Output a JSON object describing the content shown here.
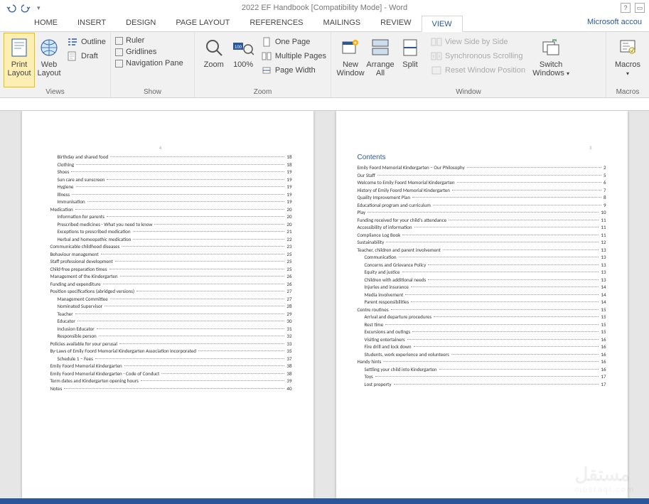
{
  "titlebar": {
    "title": "2022 EF Handbook [Compatibility Mode] - Word",
    "account": "Microsoft accou"
  },
  "tabs": {
    "items": [
      "HOME",
      "INSERT",
      "DESIGN",
      "PAGE LAYOUT",
      "REFERENCES",
      "MAILINGS",
      "REVIEW",
      "VIEW"
    ],
    "active": "VIEW"
  },
  "ribbon": {
    "views": {
      "print_layout": "Print Layout",
      "web_layout": "Web Layout",
      "outline": "Outline",
      "draft": "Draft",
      "group_label": "Views"
    },
    "show": {
      "ruler": "Ruler",
      "gridlines": "Gridlines",
      "navigation_pane": "Navigation Pane",
      "group_label": "Show"
    },
    "zoom": {
      "zoom": "Zoom",
      "hundred": "100%",
      "one_page": "One Page",
      "multiple_pages": "Multiple Pages",
      "page_width": "Page Width",
      "group_label": "Zoom"
    },
    "window": {
      "new_window": "New Window",
      "arrange_all": "Arrange All",
      "split": "Split",
      "view_side": "View Side by Side",
      "sync_scroll": "Synchronous Scrolling",
      "reset_pos": "Reset Window Position",
      "switch_windows": "Switch Windows",
      "group_label": "Window"
    },
    "macros": {
      "macros": "Macros",
      "group_label": "Macros"
    }
  },
  "left_page": {
    "number": "4",
    "toc": [
      {
        "t": "Birthday and shared food",
        "p": "18",
        "i": 2
      },
      {
        "t": "Clothing",
        "p": "18",
        "i": 2
      },
      {
        "t": "Shoes",
        "p": "19",
        "i": 2
      },
      {
        "t": "Sun care and sunscreen",
        "p": "19",
        "i": 2
      },
      {
        "t": "Hygiene",
        "p": "19",
        "i": 2
      },
      {
        "t": "Illness",
        "p": "19",
        "i": 2
      },
      {
        "t": "Immunisation",
        "p": "19",
        "i": 2
      },
      {
        "t": "Medication",
        "p": "20",
        "i": 1
      },
      {
        "t": "Information for parents",
        "p": "20",
        "i": 2
      },
      {
        "t": "Prescribed medicines - What you need to know",
        "p": "20",
        "i": 2
      },
      {
        "t": "Exceptions to prescribed medication",
        "p": "21",
        "i": 2
      },
      {
        "t": "Herbal and homeopathic medication",
        "p": "22",
        "i": 2
      },
      {
        "t": "Communicable childhood diseases",
        "p": "23",
        "i": 1
      },
      {
        "t": "Behaviour management",
        "p": "25",
        "i": 1
      },
      {
        "t": "Staff professional development",
        "p": "25",
        "i": 1
      },
      {
        "t": "Child-free preparation times",
        "p": "25",
        "i": 1
      },
      {
        "t": "Management of the Kindergarten",
        "p": "26",
        "i": 1
      },
      {
        "t": "Funding and expenditure",
        "p": "26",
        "i": 1
      },
      {
        "t": "Position specifications (abridged versions)",
        "p": "27",
        "i": 1
      },
      {
        "t": "Management Committee",
        "p": "27",
        "i": 2
      },
      {
        "t": "Nominated Supervisor",
        "p": "28",
        "i": 2
      },
      {
        "t": "Teacher",
        "p": "29",
        "i": 2
      },
      {
        "t": "Educator",
        "p": "30",
        "i": 2
      },
      {
        "t": "Inclusion Educator",
        "p": "31",
        "i": 2
      },
      {
        "t": "Responsible person",
        "p": "32",
        "i": 2
      },
      {
        "t": "Policies available for your perusal",
        "p": "33",
        "i": 1
      },
      {
        "t": "By-Laws of Emily Foord Memorial Kindergarten Association Incorporated",
        "p": "35",
        "i": 1
      },
      {
        "t": "Schedule 1 – Fees",
        "p": "37",
        "i": 2
      },
      {
        "t": "Emily Foord Memorial Kindergarten",
        "p": "38",
        "i": 1
      },
      {
        "t": "Emily Foord Memorial Kindergarten - Code of Conduct",
        "p": "38",
        "i": 1
      },
      {
        "t": "Term dates and Kindergarten opening hours",
        "p": "39",
        "i": 1
      },
      {
        "t": "Notes",
        "p": "40",
        "i": 1
      }
    ]
  },
  "right_page": {
    "number": "3",
    "heading": "Contents",
    "toc": [
      {
        "t": "Emily Foord Memorial Kindergarten – Our Philosophy",
        "p": "2",
        "i": 0
      },
      {
        "t": "Our Staff",
        "p": "5",
        "i": 0
      },
      {
        "t": "Welcome to Emily Foord Memorial Kindergarten",
        "p": "6",
        "i": 0
      },
      {
        "t": "History of Emily Foord Memorial Kindergarten",
        "p": "7",
        "i": 0
      },
      {
        "t": "Quality Improvement Plan",
        "p": "8",
        "i": 0
      },
      {
        "t": "Educational program and curriculum",
        "p": "9",
        "i": 0
      },
      {
        "t": "Play",
        "p": "10",
        "i": 0
      },
      {
        "t": "Funding received for your child's attendance",
        "p": "11",
        "i": 0
      },
      {
        "t": "Accessibility of information",
        "p": "11",
        "i": 0
      },
      {
        "t": "Compliance Log Book",
        "p": "11",
        "i": 0
      },
      {
        "t": "Sustainability",
        "p": "12",
        "i": 0
      },
      {
        "t": "Teacher, children and parent involvement",
        "p": "13",
        "i": 0
      },
      {
        "t": "Communication",
        "p": "13",
        "i": 1
      },
      {
        "t": "Concerns and Grievance Policy",
        "p": "13",
        "i": 1
      },
      {
        "t": "Equity and justice",
        "p": "13",
        "i": 1
      },
      {
        "t": "Children with additional needs",
        "p": "13",
        "i": 1
      },
      {
        "t": "Injuries and insurance",
        "p": "14",
        "i": 1
      },
      {
        "t": "Media involvement",
        "p": "14",
        "i": 1
      },
      {
        "t": "Parent responsibilities",
        "p": "14",
        "i": 1
      },
      {
        "t": "Centre routines",
        "p": "15",
        "i": 0
      },
      {
        "t": "Arrival and departure procedures",
        "p": "15",
        "i": 1
      },
      {
        "t": "Rest time",
        "p": "15",
        "i": 1
      },
      {
        "t": "Excursions and outings",
        "p": "15",
        "i": 1
      },
      {
        "t": "Visiting entertainers",
        "p": "16",
        "i": 1
      },
      {
        "t": "Fire drill and lock down",
        "p": "16",
        "i": 1
      },
      {
        "t": "Students, work experience and volunteers",
        "p": "16",
        "i": 1
      },
      {
        "t": "Handy hints",
        "p": "16",
        "i": 0
      },
      {
        "t": "Settling your child into Kindergarten",
        "p": "16",
        "i": 1
      },
      {
        "t": "Toys",
        "p": "17",
        "i": 1
      },
      {
        "t": "Lost property",
        "p": "17",
        "i": 1
      }
    ]
  },
  "watermark": {
    "main": "مستقل",
    "sub": "mostaql.com"
  }
}
